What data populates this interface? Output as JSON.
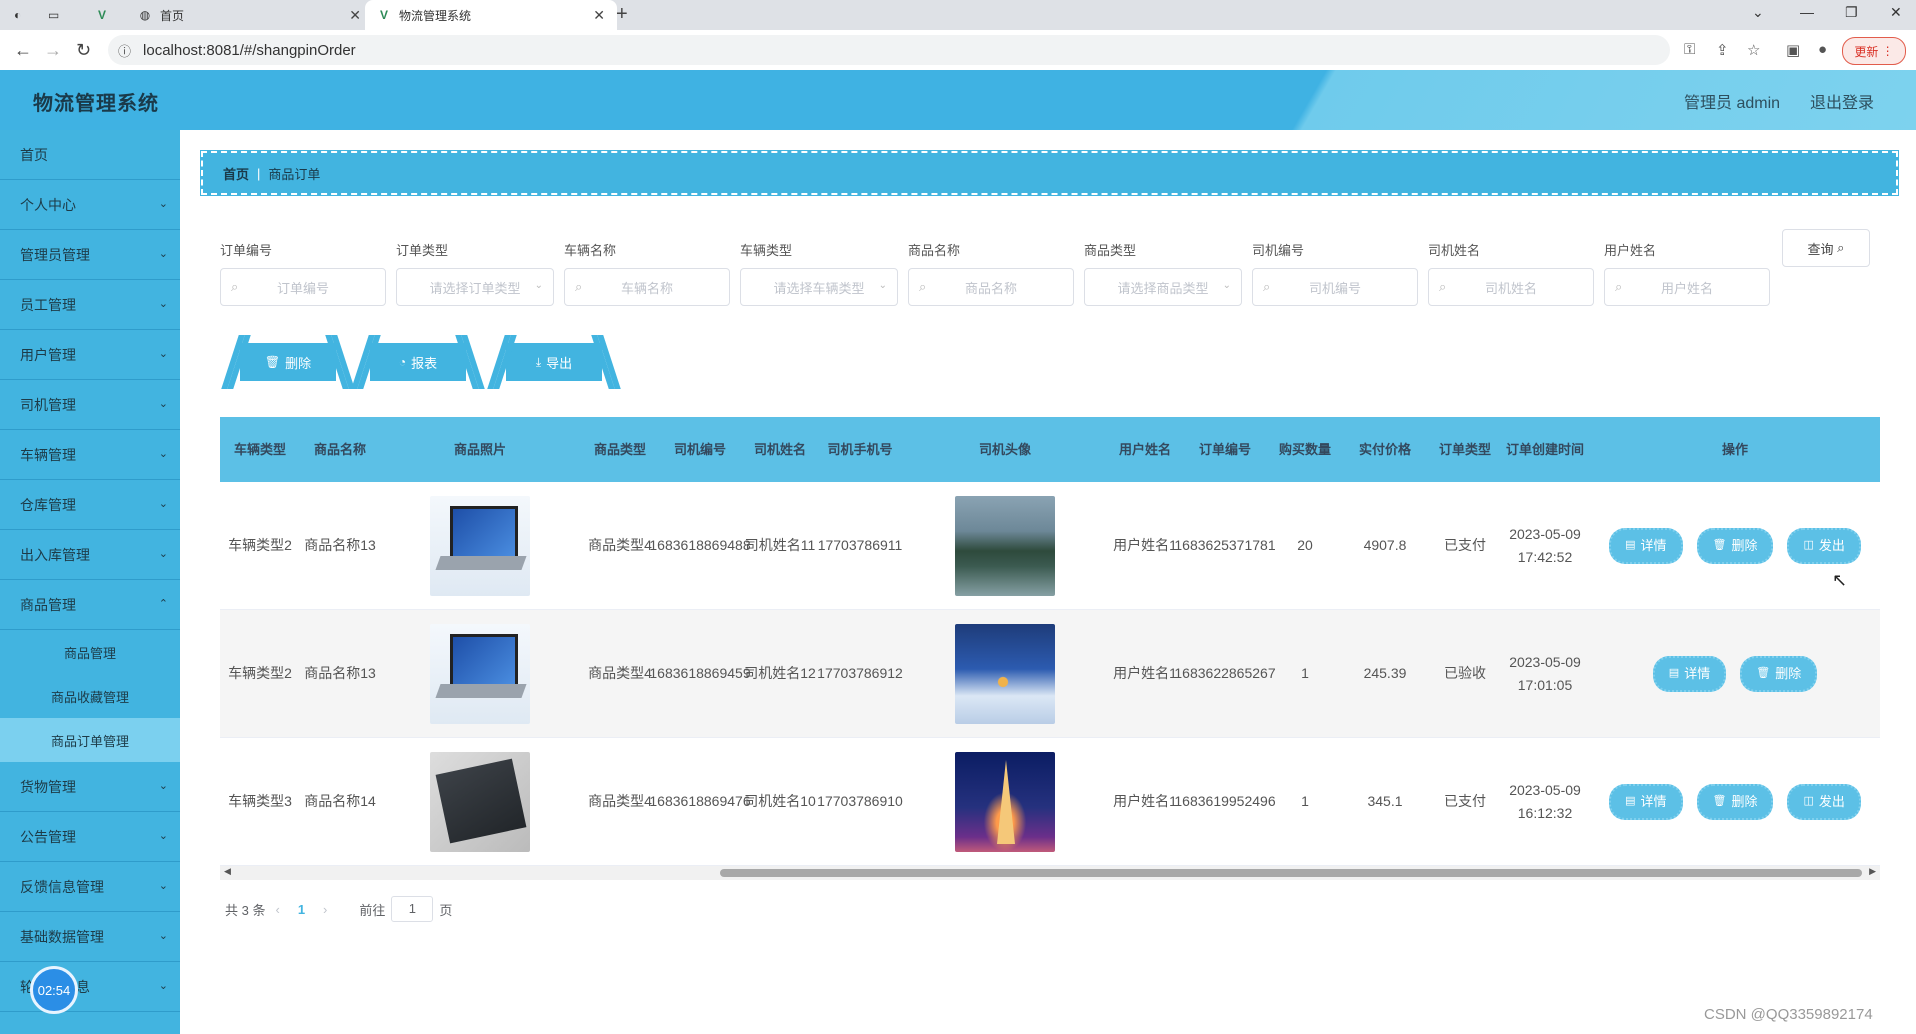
{
  "browser": {
    "tabs": [
      {
        "label": "首页"
      },
      {
        "label": "物流管理系统"
      }
    ],
    "url": "localhost:8081/#/shangpinOrder",
    "update_label": "更新"
  },
  "header": {
    "title": "物流管理系统",
    "user": "管理员 admin",
    "logout": "退出登录"
  },
  "sidebar": {
    "items": [
      {
        "label": "首页"
      },
      {
        "label": "个人中心"
      },
      {
        "label": "管理员管理"
      },
      {
        "label": "员工管理"
      },
      {
        "label": "用户管理"
      },
      {
        "label": "司机管理"
      },
      {
        "label": "车辆管理"
      },
      {
        "label": "仓库管理"
      },
      {
        "label": "出入库管理"
      },
      {
        "label": "商品管理"
      }
    ],
    "sub_items": [
      {
        "label": "商品管理"
      },
      {
        "label": "商品收藏管理"
      },
      {
        "label": "商品订单管理"
      }
    ],
    "items_after": [
      {
        "label": "货物管理"
      },
      {
        "label": "公告管理"
      },
      {
        "label": "反馈信息管理"
      },
      {
        "label": "基础数据管理"
      },
      {
        "label": "轮播图信息"
      }
    ],
    "timer": "02:54"
  },
  "breadcrumb": {
    "home": "首页",
    "current": "商品订单"
  },
  "search": {
    "fields": [
      {
        "label": "订单编号",
        "placeholder": "订单编号"
      },
      {
        "label": "订单类型",
        "placeholder": "请选择订单类型"
      },
      {
        "label": "车辆名称",
        "placeholder": "车辆名称"
      },
      {
        "label": "车辆类型",
        "placeholder": "请选择车辆类型"
      },
      {
        "label": "商品名称",
        "placeholder": "商品名称"
      },
      {
        "label": "商品类型",
        "placeholder": "请选择商品类型"
      },
      {
        "label": "司机编号",
        "placeholder": "司机编号"
      },
      {
        "label": "司机姓名",
        "placeholder": "司机姓名"
      },
      {
        "label": "用户姓名",
        "placeholder": "用户姓名"
      }
    ],
    "query_label": "查询"
  },
  "actions": {
    "delete": "删除",
    "report": "报表",
    "export": "导出"
  },
  "table": {
    "headers": [
      "车辆类型",
      "商品名称",
      "商品照片",
      "商品类型",
      "司机编号",
      "司机姓名",
      "司机手机号",
      "司机头像",
      "用户姓名",
      "订单编号",
      "购买数量",
      "实付价格",
      "订单类型",
      "订单创建时间",
      "操作"
    ],
    "rows": [
      {
        "vehicle_type": "车辆类型2",
        "product_name": "商品名称13",
        "product_type": "商品类型4",
        "driver_no": "1683618869488",
        "driver_name": "司机姓名11",
        "driver_phone": "17703786911",
        "user_name": "用户姓名1",
        "order_no": "1683625371781",
        "qty": "20",
        "price": "4907.8",
        "order_type": "已支付",
        "created": "2023-05-09 17:42:52",
        "ops": [
          "详情",
          "删除",
          "发出"
        ]
      },
      {
        "vehicle_type": "车辆类型2",
        "product_name": "商品名称13",
        "product_type": "商品类型4",
        "driver_no": "1683618869459",
        "driver_name": "司机姓名12",
        "driver_phone": "17703786912",
        "user_name": "用户姓名1",
        "order_no": "1683622865267",
        "qty": "1",
        "price": "245.39",
        "order_type": "已验收",
        "created": "2023-05-09 17:01:05",
        "ops": [
          "详情",
          "删除"
        ]
      },
      {
        "vehicle_type": "车辆类型3",
        "product_name": "商品名称14",
        "product_type": "商品类型4",
        "driver_no": "1683618869476",
        "driver_name": "司机姓名10",
        "driver_phone": "17703786910",
        "user_name": "用户姓名1",
        "order_no": "1683619952496",
        "qty": "1",
        "price": "345.1",
        "order_type": "已支付",
        "created": "2023-05-09 16:12:32",
        "ops": [
          "详情",
          "删除",
          "发出"
        ]
      }
    ]
  },
  "pager": {
    "total": "共 3 条",
    "current": "1",
    "goto": "前往",
    "page_input": "1",
    "unit": "页"
  },
  "watermark": "CSDN @QQ3359892174",
  "colors": {
    "primary": "#42b4e0",
    "header": "#3fb2e3",
    "table_head": "#5cc0e6"
  }
}
